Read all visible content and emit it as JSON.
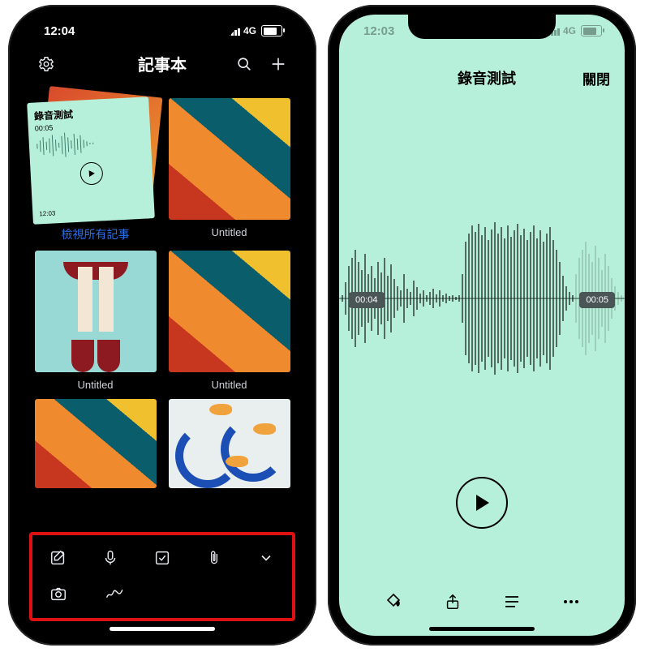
{
  "left": {
    "status": {
      "time": "12:04",
      "network": "4G"
    },
    "nav": {
      "title": "記事本"
    },
    "grid": {
      "stack_card": {
        "title": "錄音測試",
        "duration": "00:05",
        "timestamp": "12:03"
      },
      "stack_link": "檢視所有記事",
      "items": [
        {
          "label": "Untitled"
        },
        {
          "label": "Untitled"
        },
        {
          "label": "Untitled"
        }
      ]
    },
    "toolbar_icons": [
      "compose",
      "mic",
      "checklist",
      "attachment",
      "chevron",
      "camera",
      "sketch"
    ]
  },
  "right": {
    "status": {
      "time": "12:03",
      "network": "4G"
    },
    "nav": {
      "title": "錄音測試",
      "close": "關閉"
    },
    "player": {
      "current_time": "00:04",
      "total_time": "00:05"
    },
    "tabbar_icons": [
      "fill",
      "share",
      "list",
      "more"
    ]
  }
}
